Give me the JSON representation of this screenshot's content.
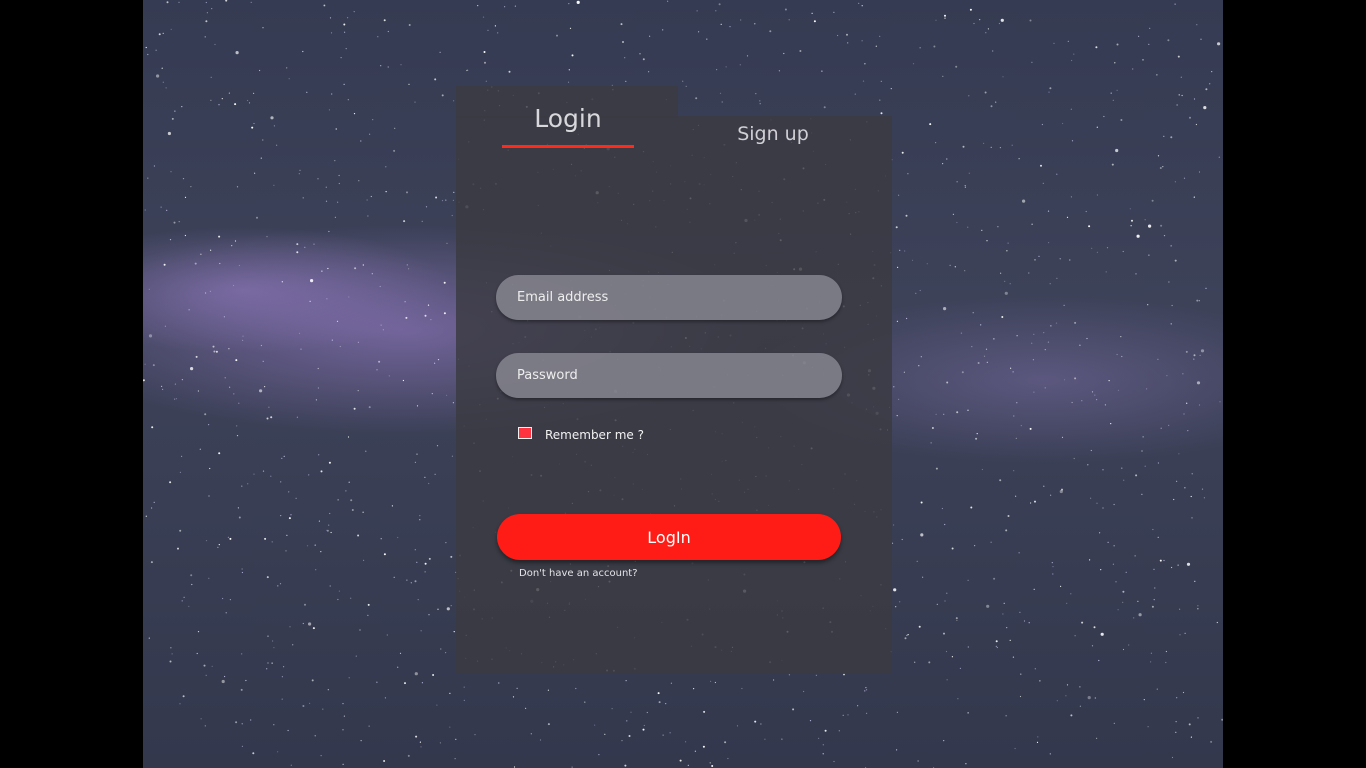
{
  "tabs": {
    "login_label": "Login",
    "signup_label": "Sign up",
    "active": "Login"
  },
  "form": {
    "email_placeholder": "Email address",
    "email_value": "",
    "password_placeholder": "Password",
    "password_value": "",
    "remember_label": "Remember me ?",
    "submit_label": "LogIn",
    "signup_prompt": "Don't have an account?"
  },
  "colors": {
    "accent": "#ff1c16",
    "checkbox": "#ff3340",
    "panel": "#3a3a42",
    "background_sky": "#3a3f55"
  }
}
